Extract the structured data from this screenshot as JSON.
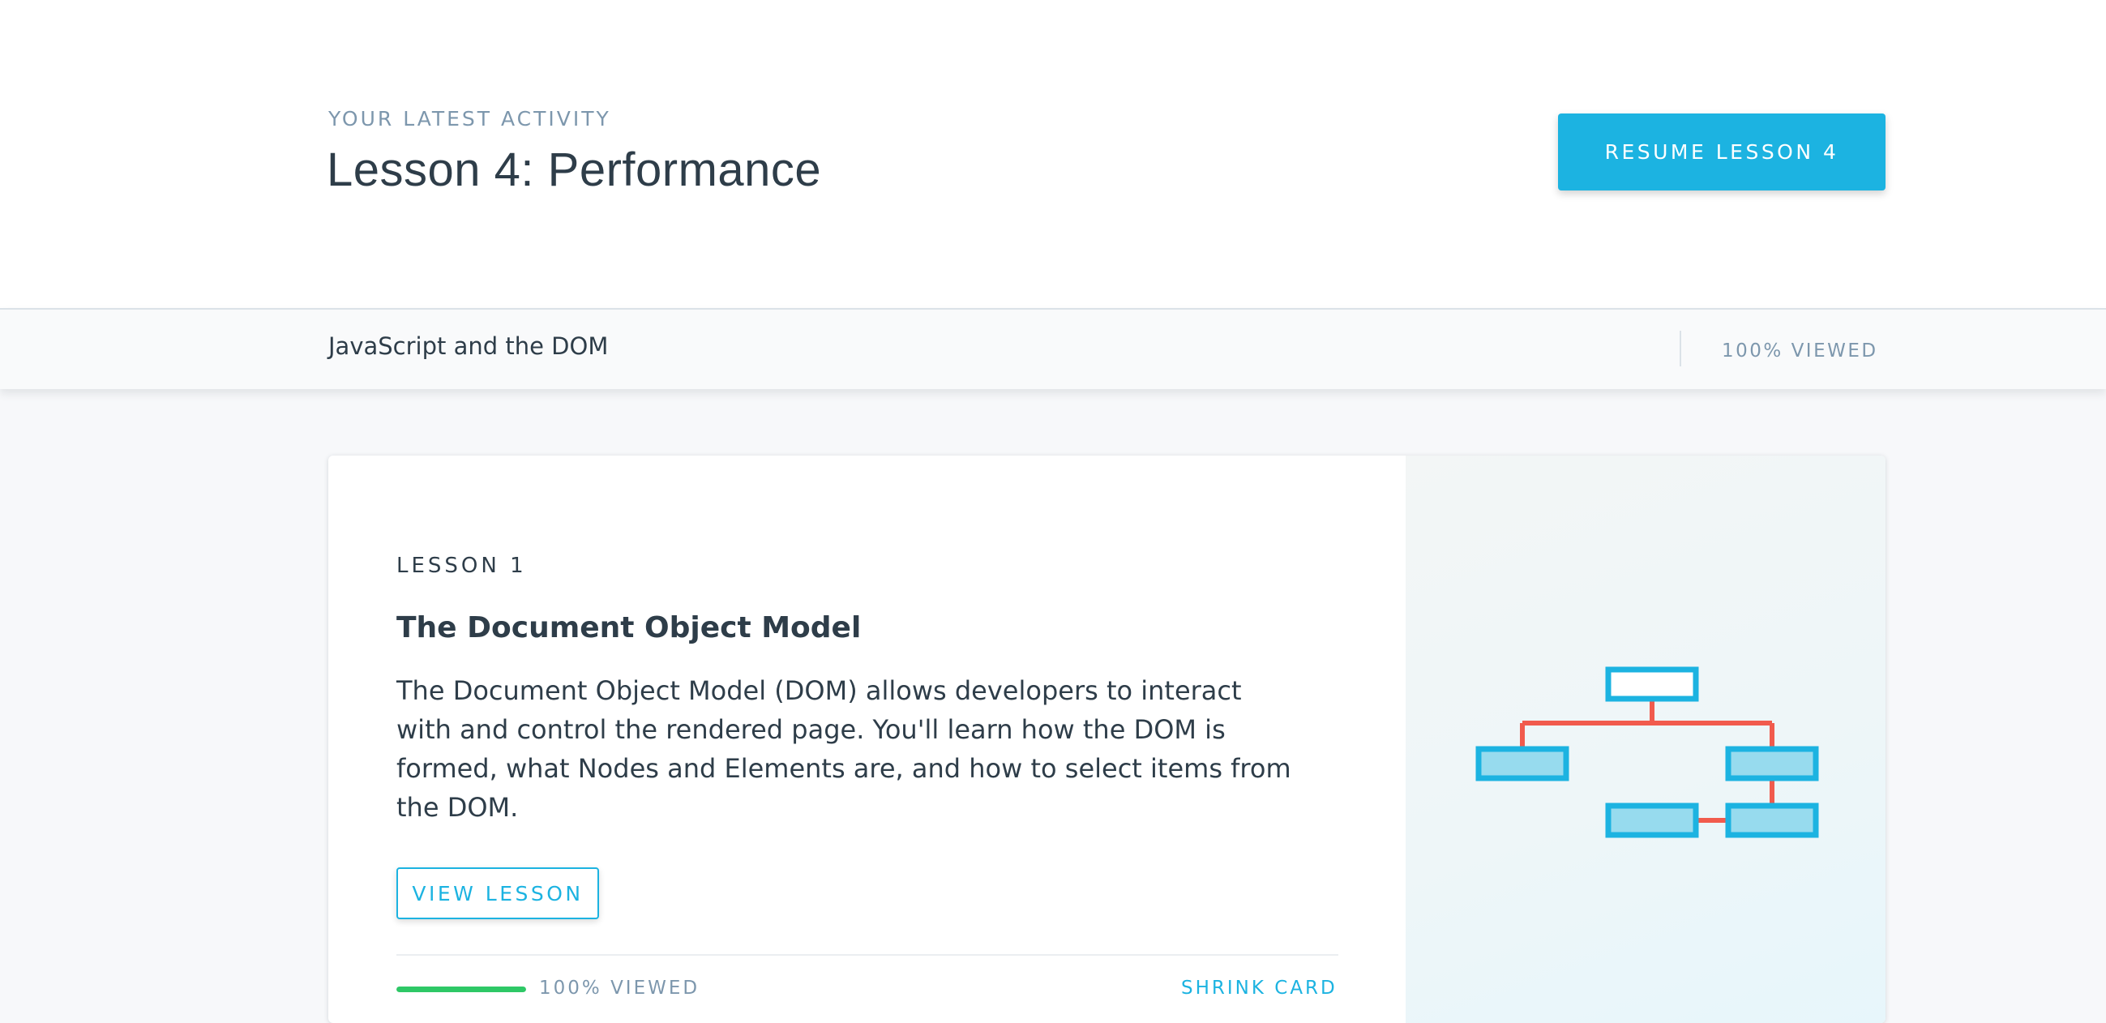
{
  "hero": {
    "eyebrow": "YOUR LATEST ACTIVITY",
    "title": "Lesson 4: Performance",
    "resume_label": "RESUME LESSON 4"
  },
  "course_bar": {
    "course_name": "JavaScript and the DOM",
    "viewed": "100% VIEWED"
  },
  "lesson_card": {
    "eyebrow": "LESSON 1",
    "title": "The Document Object Model",
    "description": "The Document Object Model (DOM) allows developers to interact with and control the rendered page. You'll learn how the DOM is formed, what Nodes and Elements are, and how to select items from the DOM.",
    "view_label": "VIEW LESSON",
    "progress": 1.0,
    "viewed": "100% VIEWED",
    "shrink_label": "SHRINK CARD",
    "illustration_icon": "dom-tree-icon"
  },
  "colors": {
    "accent": "#1cb3e1",
    "progress": "#2ec866",
    "tree_connector": "#f15b4d",
    "tree_node_fill": "#97dbee",
    "text_primary": "#2e3d49",
    "text_muted": "#7d97ad"
  }
}
